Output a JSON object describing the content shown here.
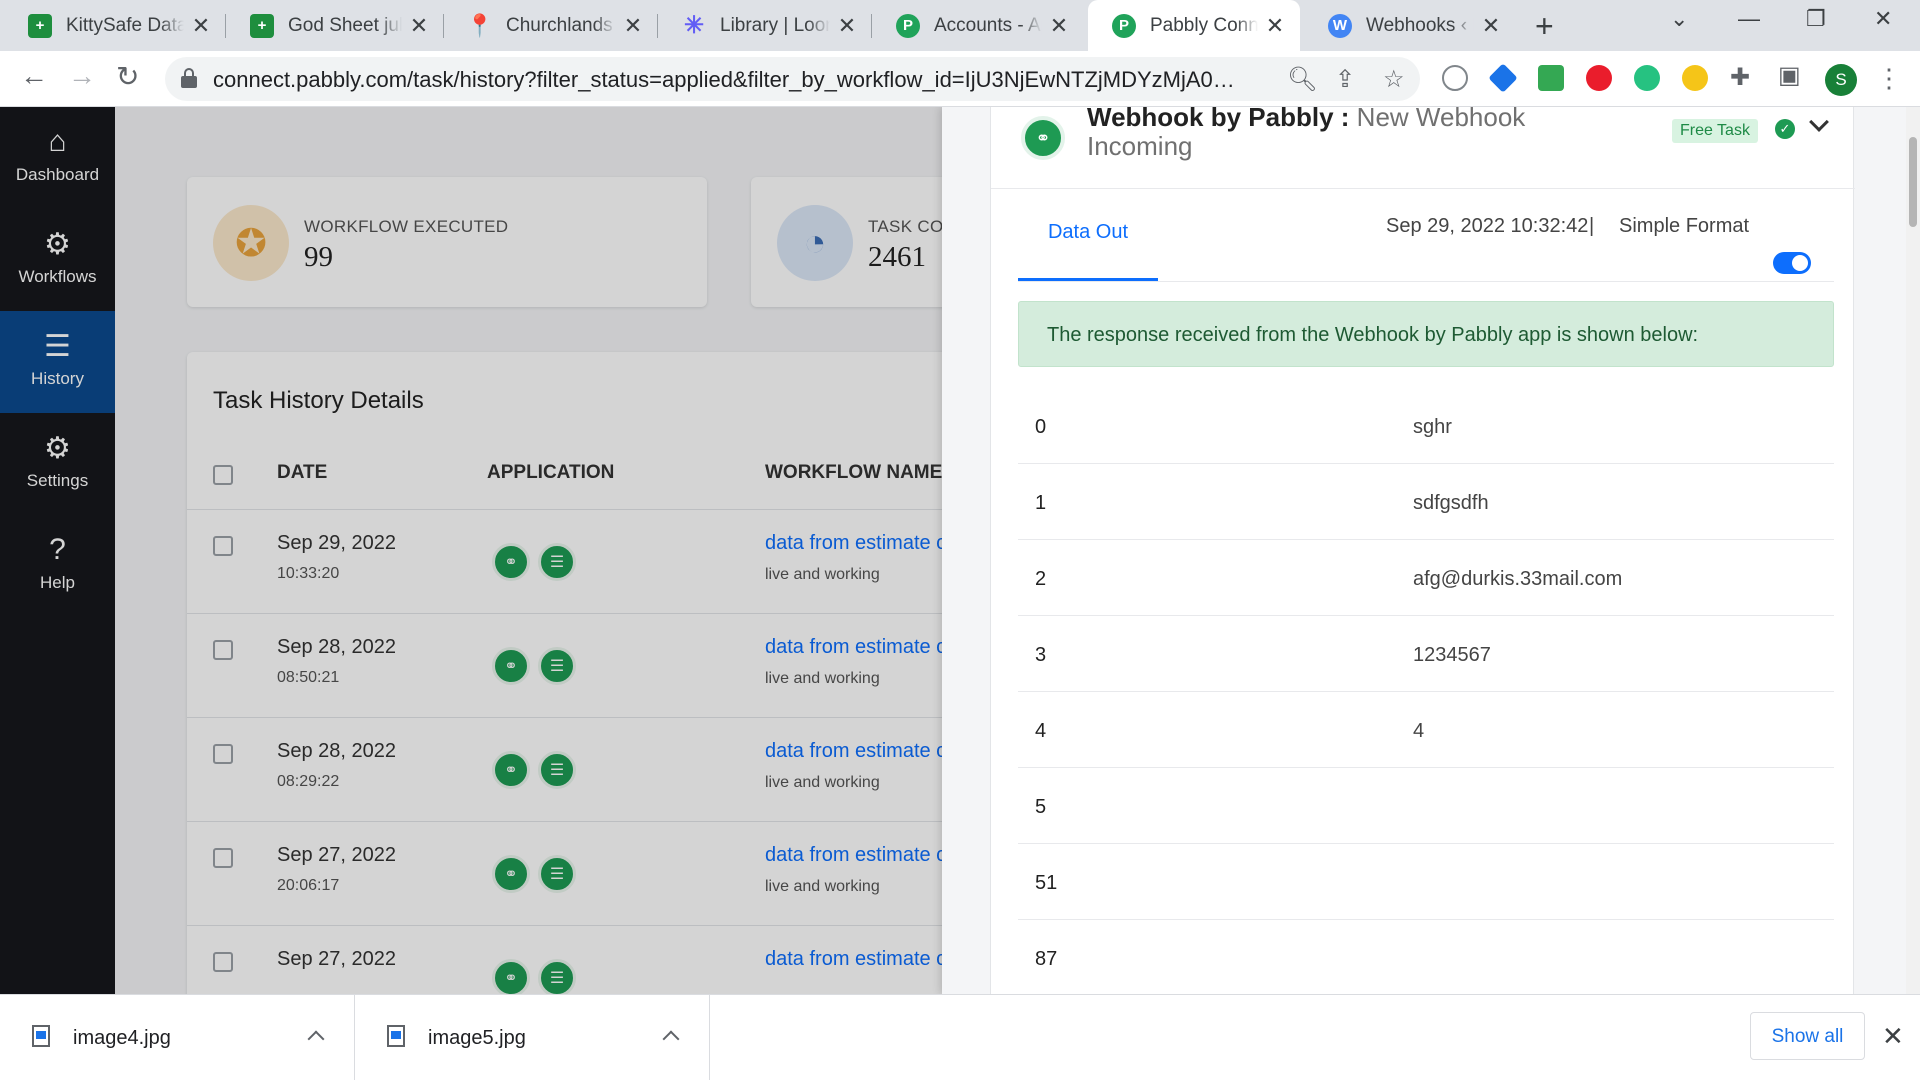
{
  "browser": {
    "tabs": [
      {
        "title": "KittySafe Datab",
        "icon": "google-sheets-icon",
        "color": "#1e8e3e",
        "glyph": "+"
      },
      {
        "title": "God Sheet julia",
        "icon": "google-sheets-icon",
        "color": "#1e8e3e",
        "glyph": "+"
      },
      {
        "title": "Churchlands - G",
        "icon": "google-maps-icon",
        "color": "#ea4335",
        "glyph": "⬤"
      },
      {
        "title": "Library | Loom",
        "icon": "loom-icon",
        "color": "#625df5",
        "glyph": "✳"
      },
      {
        "title": "Accounts - App",
        "icon": "pabbly-icon",
        "color": "#20a35a",
        "glyph": "P"
      },
      {
        "title": "Pabbly Connect",
        "icon": "pabbly-icon",
        "color": "#20a35a",
        "glyph": "P"
      },
      {
        "title": "Webhooks ‹ Fo",
        "icon": "wordpress-icon",
        "color": "#4285f4",
        "glyph": "W"
      }
    ],
    "active_tab": 5,
    "url": "connect.pabbly.com/task/history?filter_status=applied&filter_by_workflow_id=IjU3NjEwNTZjMDYzMjA0MzI1MjY...",
    "profile_initial": "S"
  },
  "sidebar": {
    "items": [
      {
        "label": "Dashboard",
        "icon": "home-icon",
        "glyph": "⌂"
      },
      {
        "label": "Workflows",
        "icon": "workflow-gear-icon",
        "glyph": "⚙"
      },
      {
        "label": "History",
        "icon": "list-icon",
        "glyph": "☰"
      },
      {
        "label": "Settings",
        "icon": "settings-icon",
        "glyph": "⚙"
      },
      {
        "label": "Help",
        "icon": "help-icon",
        "glyph": "?"
      }
    ],
    "active": "History"
  },
  "stats": [
    {
      "label": "WORKFLOW EXECUTED",
      "value": "99",
      "icon": "badge-check-icon",
      "color": "#e8a33d"
    },
    {
      "label": "TASK CON",
      "value": "2461",
      "icon": "pie-chart-icon",
      "color": "#3b6db5"
    }
  ],
  "history": {
    "title": "Task History Details",
    "columns": {
      "date": "DATE",
      "application": "APPLICATION",
      "workflow": "WORKFLOW NAME"
    },
    "rows": [
      {
        "date": "Sep 29, 2022",
        "time": "10:33:20",
        "workflow": "data from estimate created",
        "status": "live and working"
      },
      {
        "date": "Sep 28, 2022",
        "time": "08:50:21",
        "workflow": "data from estimate created",
        "status": "live and working"
      },
      {
        "date": "Sep 28, 2022",
        "time": "08:29:22",
        "workflow": "data from estimate created",
        "status": "live and working"
      },
      {
        "date": "Sep 27, 2022",
        "time": "20:06:17",
        "workflow": "data from estimate created",
        "status": "live and working"
      },
      {
        "date": "Sep 27, 2022",
        "time": "",
        "workflow": "data from estimate created",
        "status": ""
      }
    ]
  },
  "panel": {
    "app_name": "Webhook by Pabbly : ",
    "event": "New Webhook Incoming",
    "badge": "Free Task",
    "tab": "Data Out",
    "timestamp": "Sep 29, 2022 10:32:42",
    "separator": "|",
    "format_label": "Simple Format",
    "simple_format_on": true,
    "alert": "The response received from the Webhook by Pabbly app is shown below:",
    "data": [
      {
        "key": "0",
        "value": "sghr"
      },
      {
        "key": "1",
        "value": "sdfgsdfh"
      },
      {
        "key": "2",
        "value": "afg@durkis.33mail.com"
      },
      {
        "key": "3",
        "value": "1234567"
      },
      {
        "key": "4",
        "value": "4"
      },
      {
        "key": "5",
        "value": ""
      },
      {
        "key": "51",
        "value": ""
      },
      {
        "key": "87",
        "value": ""
      }
    ]
  },
  "downloads": {
    "items": [
      {
        "name": "image4.jpg"
      },
      {
        "name": "image5.jpg"
      }
    ],
    "show_all": "Show all"
  }
}
